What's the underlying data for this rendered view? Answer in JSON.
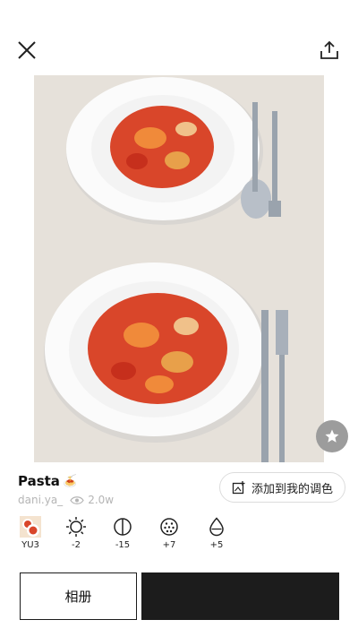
{
  "header": {
    "close_icon": "close-icon",
    "share_icon": "share-icon"
  },
  "photo": {
    "description_icon": "pasta-photo",
    "favorite_icon": "star-icon"
  },
  "post": {
    "title": "Pasta",
    "title_emoji": "🍝",
    "author": "dani.ya_",
    "views": "2.0w"
  },
  "add_button": {
    "label": "添加到我的调色",
    "icon": "add-palette-icon"
  },
  "tools": [
    {
      "icon": "filter-thumbnail",
      "value": "YU3"
    },
    {
      "icon": "brightness-icon",
      "value": "-2"
    },
    {
      "icon": "contrast-icon",
      "value": "-15"
    },
    {
      "icon": "grain-icon",
      "value": "+7"
    },
    {
      "icon": "saturation-icon",
      "value": "+5"
    }
  ],
  "bottom": {
    "album_label": "相册"
  },
  "colors": {
    "dark": "#1c1c1c",
    "muted": "#b5b5b5",
    "sauce": "#d9462a"
  }
}
